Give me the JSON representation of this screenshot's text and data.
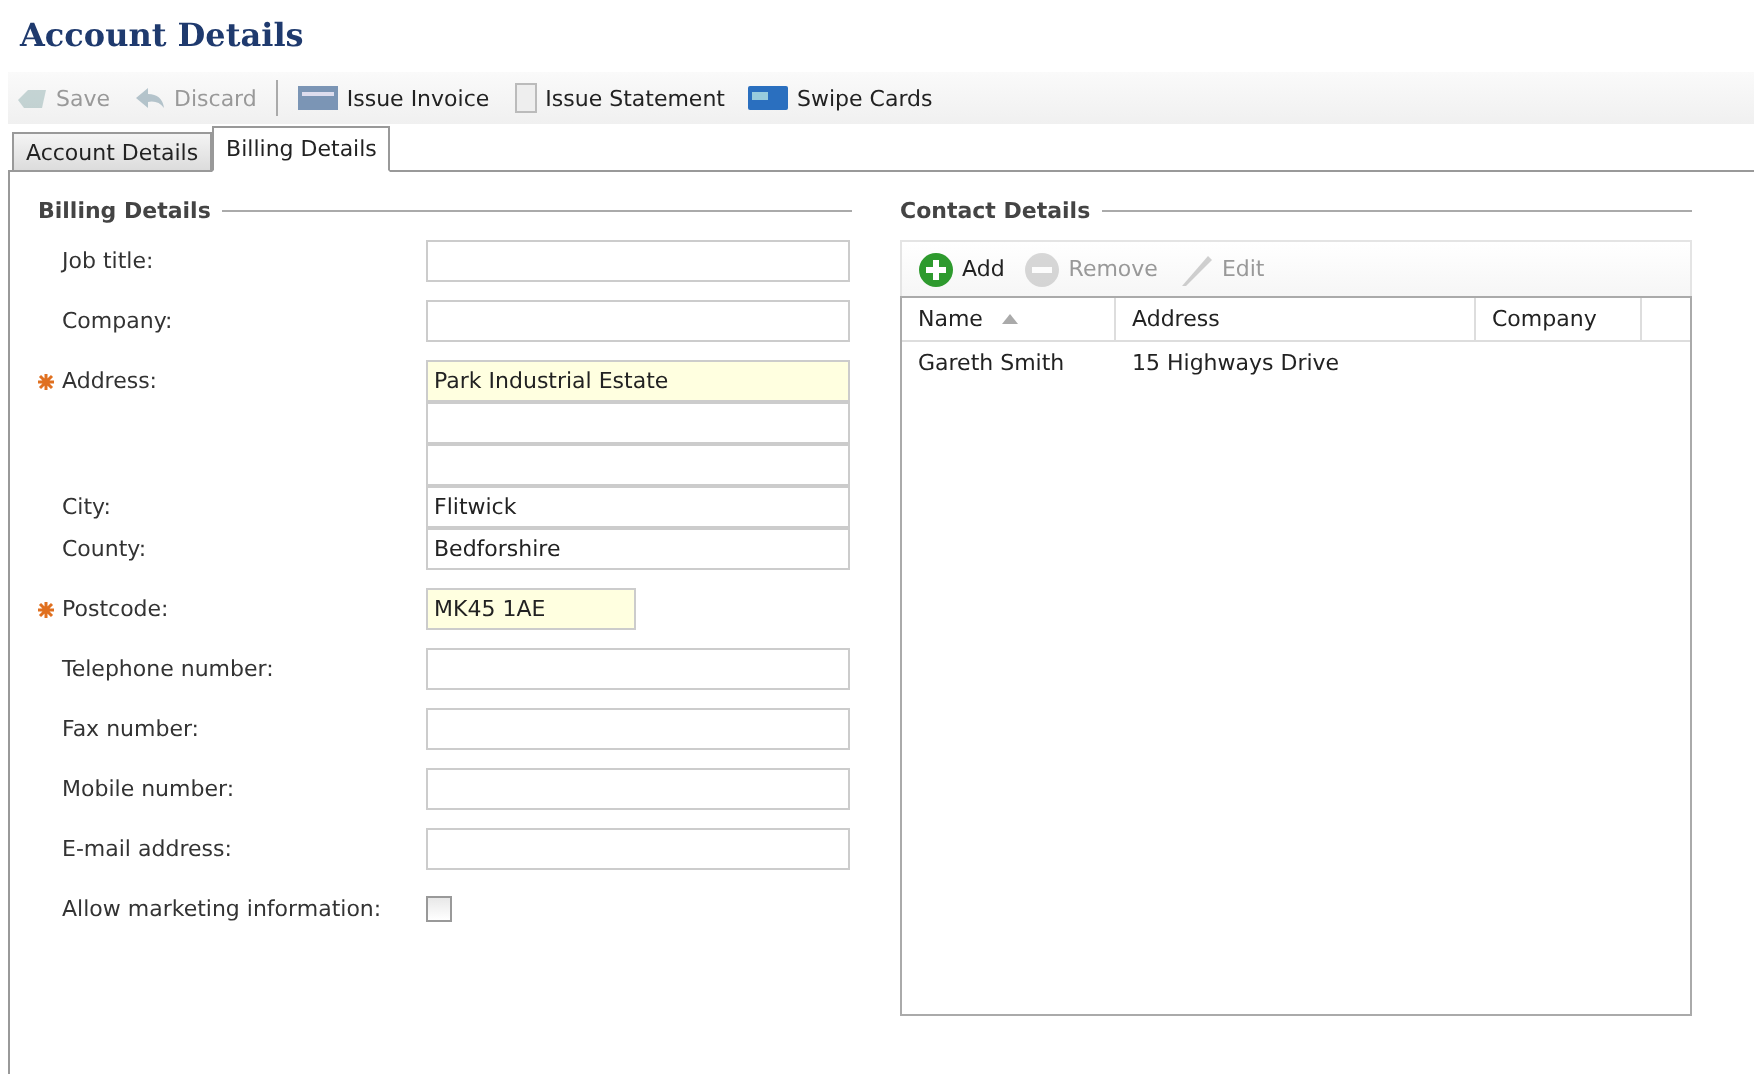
{
  "title": "Account Details",
  "toolbar": [
    {
      "label": "Save",
      "kind": "save",
      "disabled": true
    },
    {
      "label": "Discard",
      "kind": "discard",
      "disabled": true
    },
    {
      "kind": "separator"
    },
    {
      "label": "Issue Invoice",
      "kind": "invoice",
      "disabled": false
    },
    {
      "label": "Issue Statement",
      "kind": "statement",
      "disabled": false
    },
    {
      "label": "Swipe Cards",
      "kind": "card",
      "disabled": false
    }
  ],
  "tabs": [
    {
      "label": "Account Details",
      "selected": false
    },
    {
      "label": "Billing Details",
      "selected": true
    }
  ],
  "billing": {
    "title": "Billing Details",
    "groups": [
      {
        "rows": [
          {
            "label": "Job title:",
            "required": false,
            "kind": "text",
            "highlighted": false
          }
        ]
      },
      {
        "rows": [
          {
            "label": "Company:",
            "required": false,
            "kind": "text",
            "highlighted": false
          }
        ]
      },
      {
        "rows": [
          {
            "label": "Address:",
            "required": true,
            "kind": "text",
            "highlighted": true,
            "value": "Park Industrial Estate"
          },
          {
            "required": false,
            "kind": "text",
            "highlighted": false
          },
          {
            "required": false,
            "kind": "text",
            "highlighted": false
          },
          {
            "label": "City:",
            "required": false,
            "kind": "text",
            "highlighted": false,
            "value": "Flitwick"
          },
          {
            "label": "County:",
            "required": false,
            "kind": "text",
            "highlighted": false,
            "value": "Bedforshire"
          }
        ]
      },
      {
        "rows": [
          {
            "label": "Postcode:",
            "required": true,
            "kind": "short",
            "highlighted": true,
            "value": "MK45 1AE"
          }
        ]
      },
      {
        "rows": [
          {
            "label": "Telephone number:",
            "required": false,
            "kind": "text",
            "highlighted": false
          }
        ]
      },
      {
        "rows": [
          {
            "label": "Fax number:",
            "required": false,
            "kind": "text",
            "highlighted": false
          }
        ]
      },
      {
        "rows": [
          {
            "label": "Mobile number:",
            "required": false,
            "kind": "text",
            "highlighted": false
          }
        ]
      },
      {
        "rows": [
          {
            "label": "E-mail address:",
            "required": false,
            "kind": "text",
            "highlighted": false
          }
        ]
      },
      {
        "rows": [
          {
            "label": "Allow marketing information:",
            "required": false,
            "kind": "checkbox",
            "checked": false
          }
        ]
      }
    ]
  },
  "contacts": {
    "title": "Contact Details",
    "toolbar": [
      {
        "label": "Add",
        "kind": "add",
        "disabled": false
      },
      {
        "label": "Remove",
        "kind": "remove",
        "disabled": true
      },
      {
        "label": "Edit",
        "kind": "edit",
        "disabled": true
      }
    ],
    "columns": [
      {
        "label": "Name",
        "sorted": true
      },
      {
        "label": "Address",
        "sorted": false
      },
      {
        "label": "Company",
        "sorted": false
      }
    ],
    "rows": [
      [
        "Gareth Smith",
        "15 Highways Drive",
        ""
      ]
    ]
  }
}
